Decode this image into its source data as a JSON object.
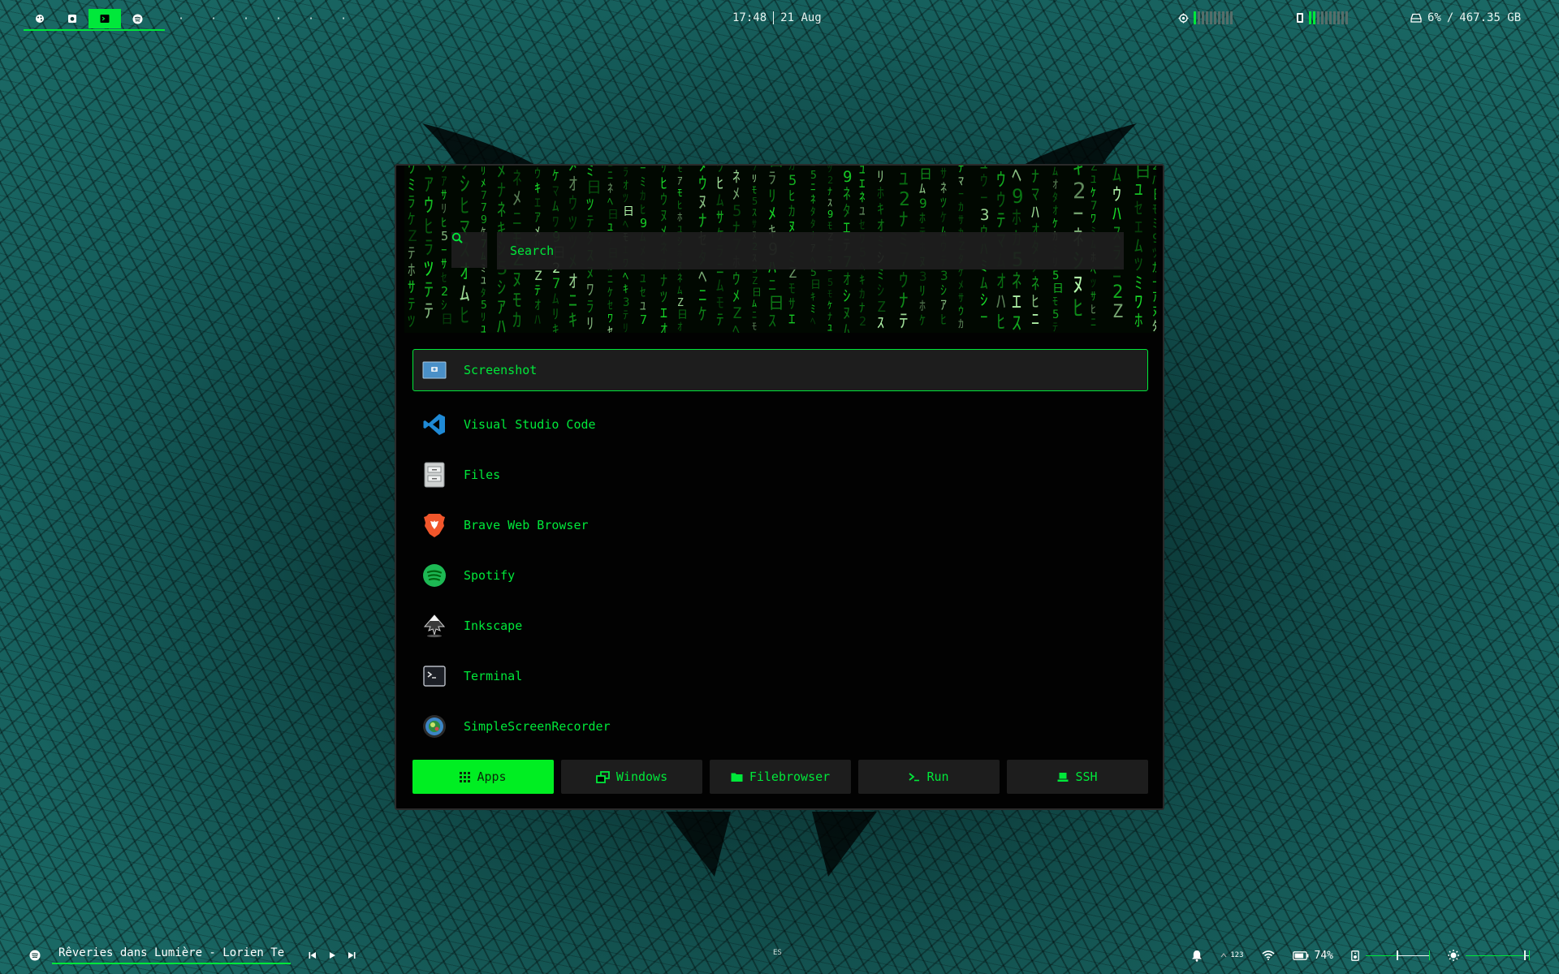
{
  "topbar": {
    "workspaces": [
      {
        "icon": "palette-icon",
        "active": false
      },
      {
        "icon": "camera-icon",
        "active": false
      },
      {
        "icon": "terminal-icon",
        "active": true
      },
      {
        "icon": "spotify-icon",
        "active": false
      }
    ],
    "empty_workspaces": [
      "·",
      "·",
      "·",
      "·",
      "·",
      "·"
    ],
    "time": "17:48",
    "date": "21 Aug",
    "cpu_level": 0.1,
    "memory_level": 0.2,
    "disk_usage": "6%",
    "disk_separator": "/",
    "disk_total": "467.35 GB"
  },
  "launcher": {
    "search_placeholder": "Search",
    "apps": [
      {
        "label": "Screenshot",
        "icon": "screenshot-icon",
        "selected": true
      },
      {
        "label": "Visual Studio Code",
        "icon": "vscode-icon",
        "selected": false
      },
      {
        "label": "Files",
        "icon": "files-icon",
        "selected": false
      },
      {
        "label": "Brave Web Browser",
        "icon": "brave-icon",
        "selected": false
      },
      {
        "label": "Spotify",
        "icon": "spotify-icon",
        "selected": false
      },
      {
        "label": "Inkscape",
        "icon": "inkscape-icon",
        "selected": false
      },
      {
        "label": "Terminal",
        "icon": "terminal-icon",
        "selected": false
      },
      {
        "label": "SimpleScreenRecorder",
        "icon": "recorder-icon",
        "selected": false
      }
    ],
    "modes": [
      {
        "label": "Apps",
        "icon": "grid-icon",
        "active": true
      },
      {
        "label": "Windows",
        "icon": "windows-icon",
        "active": false
      },
      {
        "label": "Filebrowser",
        "icon": "folder-icon",
        "active": false
      },
      {
        "label": "Run",
        "icon": "prompt-icon",
        "active": false
      },
      {
        "label": "SSH",
        "icon": "laptop-icon",
        "active": false
      }
    ]
  },
  "bottombar": {
    "song": "Rêveries dans Lumière - Lorien Te",
    "keyboard_layout": "ES",
    "notifications_count": "123",
    "battery": "74%",
    "volume_level": 0.5,
    "brightness_level": 0.95
  },
  "colors": {
    "accent": "#00e83a",
    "panel": "#020202",
    "item_bg": "#1d1d1d"
  }
}
